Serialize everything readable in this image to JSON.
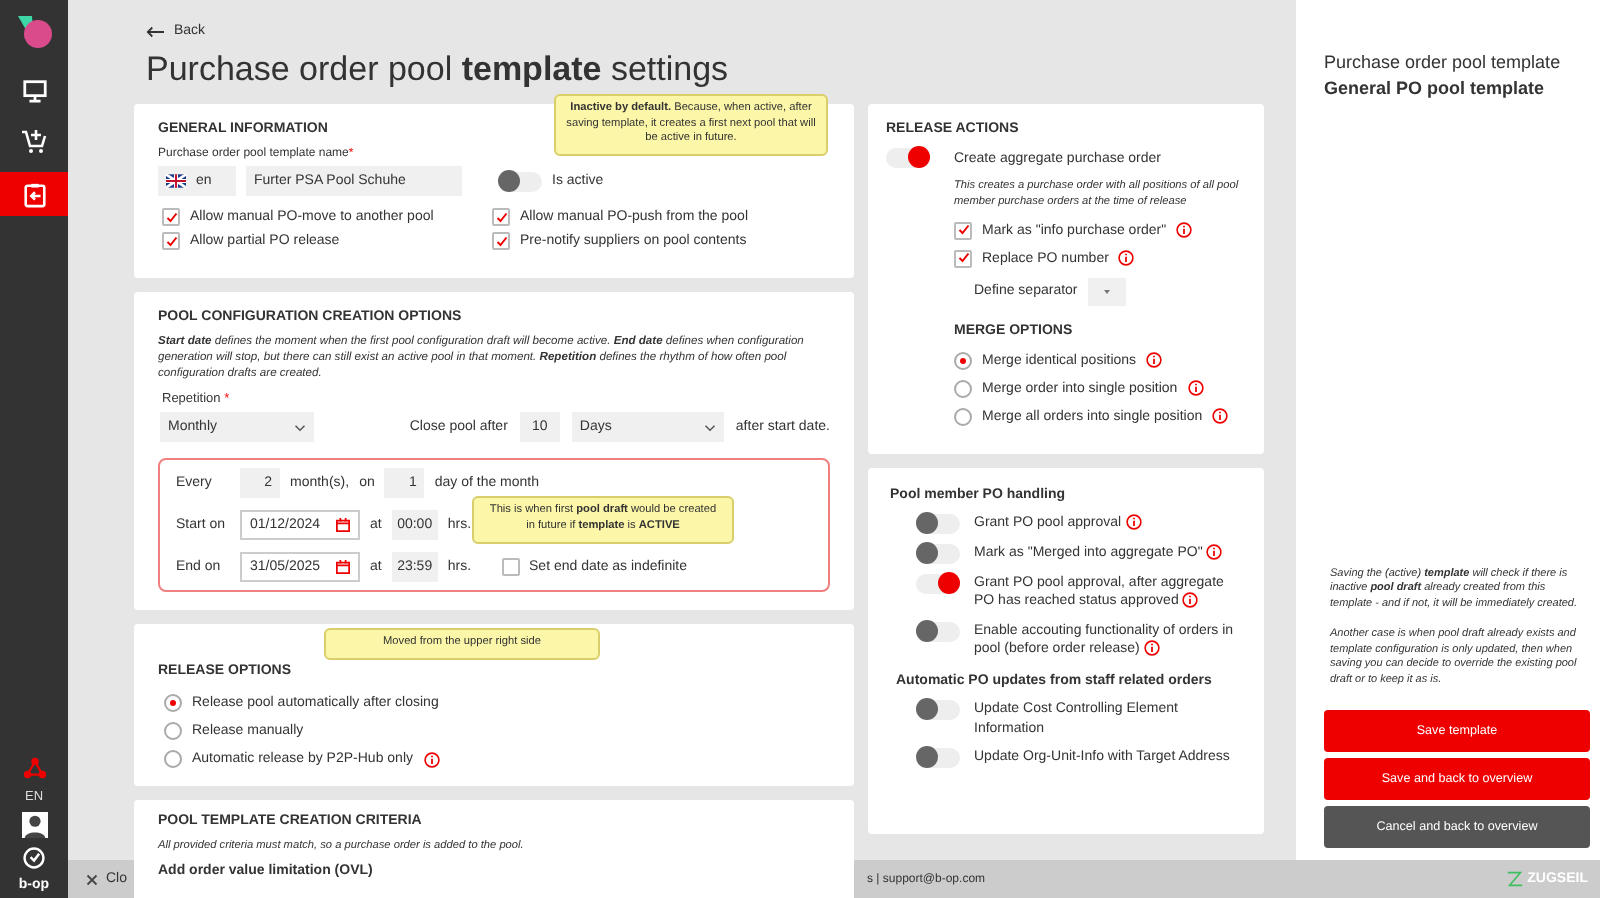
{
  "sidebar": {
    "nav": [
      {
        "selected": false
      },
      {
        "selected": false
      },
      {
        "selected": true
      }
    ],
    "language": "EN",
    "brand": "b-op"
  },
  "back": "Back",
  "title": "Purchase order pool **template** settings",
  "general": {
    "heading": "GENERAL INFORMATION",
    "name_label": "Purchase order pool template name",
    "required": "*",
    "lang": "en",
    "name_value": "Furter PSA Pool Schuhe",
    "active": {
      "label": "Is active",
      "on": false
    },
    "tooltip": "**Inactive by default.** Because, when active, after saving template, it creates a first next pool that will be active in future.",
    "checkboxes": [
      {
        "label": "Allow manual PO-move to another pool",
        "checked": true
      },
      {
        "label": "Allow manual PO-push from the pool",
        "checked": true
      },
      {
        "label": "Allow partial PO release",
        "checked": true
      },
      {
        "label": "Pre-notify suppliers on pool contents",
        "checked": true
      }
    ]
  },
  "config": {
    "heading": "POOL CONFIGURATION CREATION OPTIONS",
    "description": "**Start date** defines the moment when the first pool configuration draft will become active. **End date** defines when configuration generation will stop, but there can still exist an active pool in that moment. **Repetition** defines the rhythm of how often pool configuration drafts are created.",
    "repetition_label": "Repetition",
    "required": "*",
    "repetition": "Monthly",
    "close_label": "Close pool after",
    "close_value": "10",
    "close_unit": "Days",
    "after_label": "after start date.",
    "every_label": "Every",
    "every_value": "2",
    "months_label": "month(s),",
    "on_label": "on",
    "day_value": "1",
    "day_label": "day of the month",
    "start_label": "Start on",
    "start_date": "01/12/2024",
    "at_label": "at",
    "start_time": "00:00",
    "hrs": "hrs.",
    "end_label": "End on",
    "end_date": "31/05/2025",
    "end_at_label": "at",
    "end_time": "23:59",
    "end_hrs": "hrs.",
    "indefinite": {
      "label": "Set end date as indefinite",
      "checked": false
    },
    "tooltip": "This is when first **pool draft** would be created in future if **template** is **ACTIVE**"
  },
  "release_options": {
    "heading": "RELEASE OPTIONS",
    "tooltip": "Moved from the upper right side",
    "options": [
      {
        "label": "Release pool automatically after closing",
        "selected": true,
        "info": false
      },
      {
        "label": "Release manually",
        "selected": false,
        "info": false
      },
      {
        "label": "Automatic release by P2P-Hub only",
        "selected": false,
        "info": true
      }
    ]
  },
  "criteria": {
    "heading": "POOL TEMPLATE CREATION CRITERIA",
    "note": "All provided criteria must match, so a purchase order is added to the pool.",
    "subheading": "Add order value limitation (OVL)"
  },
  "release_actions": {
    "heading": "RELEASE ACTIONS",
    "aggregate": {
      "label": "Create aggregate purchase order",
      "on": true
    },
    "note": "This creates a purchase order with all positions of all pool member purchase orders at the time of release",
    "checks": [
      {
        "label": "Mark as \"info purchase order\"",
        "checked": true
      },
      {
        "label": "Replace PO number",
        "checked": true
      }
    ],
    "separator_label": "Define separator",
    "merge_heading": "MERGE OPTIONS",
    "merge": [
      {
        "label": "Merge identical positions",
        "selected": true
      },
      {
        "label": "Merge order into single position",
        "selected": false
      },
      {
        "label": "Merge all orders into single position",
        "selected": false
      }
    ]
  },
  "member": {
    "heading": "Pool member PO handling",
    "toggles": [
      {
        "label": "Grant PO pool approval",
        "on": false,
        "info": true
      },
      {
        "label": "Mark as \"Merged into aggregate PO\"",
        "on": false,
        "info": true
      },
      {
        "label": "Grant PO pool approval, after aggregate PO has reached status approved",
        "on": true,
        "info": true
      },
      {
        "label": "Enable accouting functionality of orders in pool (before order release)",
        "on": false,
        "info": true
      }
    ],
    "updates_heading": "Automatic PO updates from staff related orders",
    "updates": [
      {
        "label": "Update Cost Controlling Element Information",
        "on": false
      },
      {
        "label": "Update Org-Unit-Info with Target Address",
        "on": false
      }
    ]
  },
  "panel": {
    "title": "Purchase order pool template",
    "subtitle": "General PO pool template",
    "notes": [
      "Saving the (active) **template** will check if there is inactive **pool draft** already created from this template - and if not, it will be immediately created.",
      "Another case is when pool draft already exists and template configuration is only updated, then when saving you can decide to override the existing pool draft or to keep it as is."
    ],
    "buttons": [
      {
        "label": "Save template",
        "kind": "primary"
      },
      {
        "label": "Save and back to overview",
        "kind": "primary"
      },
      {
        "label": "Cancel and back to overview",
        "kind": "secondary"
      }
    ]
  },
  "footer": {
    "close_text": "Clo",
    "contact": "s | support@b-op.com",
    "logo": "ZUGSEIL"
  }
}
